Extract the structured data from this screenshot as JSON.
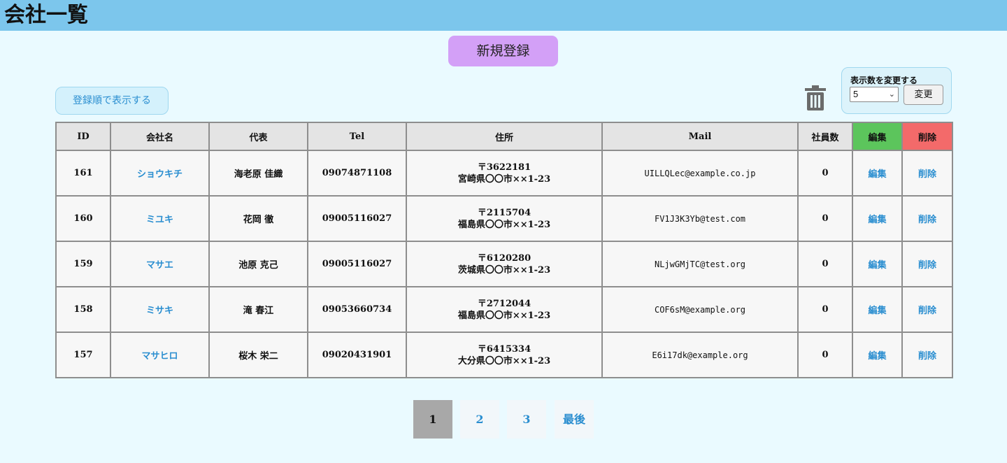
{
  "header": {
    "title": "会社一覧"
  },
  "actions": {
    "new_label": "新規登録",
    "order_label": "登録順で表示する"
  },
  "display_count": {
    "label": "表示数を変更する",
    "selected": "5",
    "submit_label": "変更"
  },
  "table": {
    "columns": [
      "ID",
      "会社名",
      "代表",
      "Tel",
      "住所",
      "Mail",
      "社員数",
      "編集",
      "削除"
    ],
    "rows": [
      {
        "id": "161",
        "company": "ショウキチ",
        "rep": "海老原 佳織",
        "tel": "09074871108",
        "zip": "〒3622181",
        "addr": "宮崎県〇〇市××1-23",
        "mail": "UILLQLec@example.co.jp",
        "employees": "0",
        "edit": "編集",
        "delete": "削除"
      },
      {
        "id": "160",
        "company": "ミユキ",
        "rep": "花岡 徹",
        "tel": "09005116027",
        "zip": "〒2115704",
        "addr": "福島県〇〇市××1-23",
        "mail": "FV1J3K3Yb@test.com",
        "employees": "0",
        "edit": "編集",
        "delete": "削除"
      },
      {
        "id": "159",
        "company": "マサエ",
        "rep": "池原 克己",
        "tel": "09005116027",
        "zip": "〒6120280",
        "addr": "茨城県〇〇市××1-23",
        "mail": "NLjwGMjTC@test.org",
        "employees": "0",
        "edit": "編集",
        "delete": "削除"
      },
      {
        "id": "158",
        "company": "ミサキ",
        "rep": "滝 春江",
        "tel": "09053660734",
        "zip": "〒2712044",
        "addr": "福島県〇〇市××1-23",
        "mail": "COF6sM@example.org",
        "employees": "0",
        "edit": "編集",
        "delete": "削除"
      },
      {
        "id": "157",
        "company": "マサヒロ",
        "rep": "桜木 栄二",
        "tel": "09020431901",
        "zip": "〒6415334",
        "addr": "大分県〇〇市××1-23",
        "mail": "E6i17dk@example.org",
        "employees": "0",
        "edit": "編集",
        "delete": "削除"
      }
    ]
  },
  "pagination": {
    "pages": [
      "1",
      "2",
      "3"
    ],
    "last_label": "最後",
    "current": "1"
  },
  "icons": {
    "trash": "trash-icon",
    "select": "chevron-down-icon"
  }
}
